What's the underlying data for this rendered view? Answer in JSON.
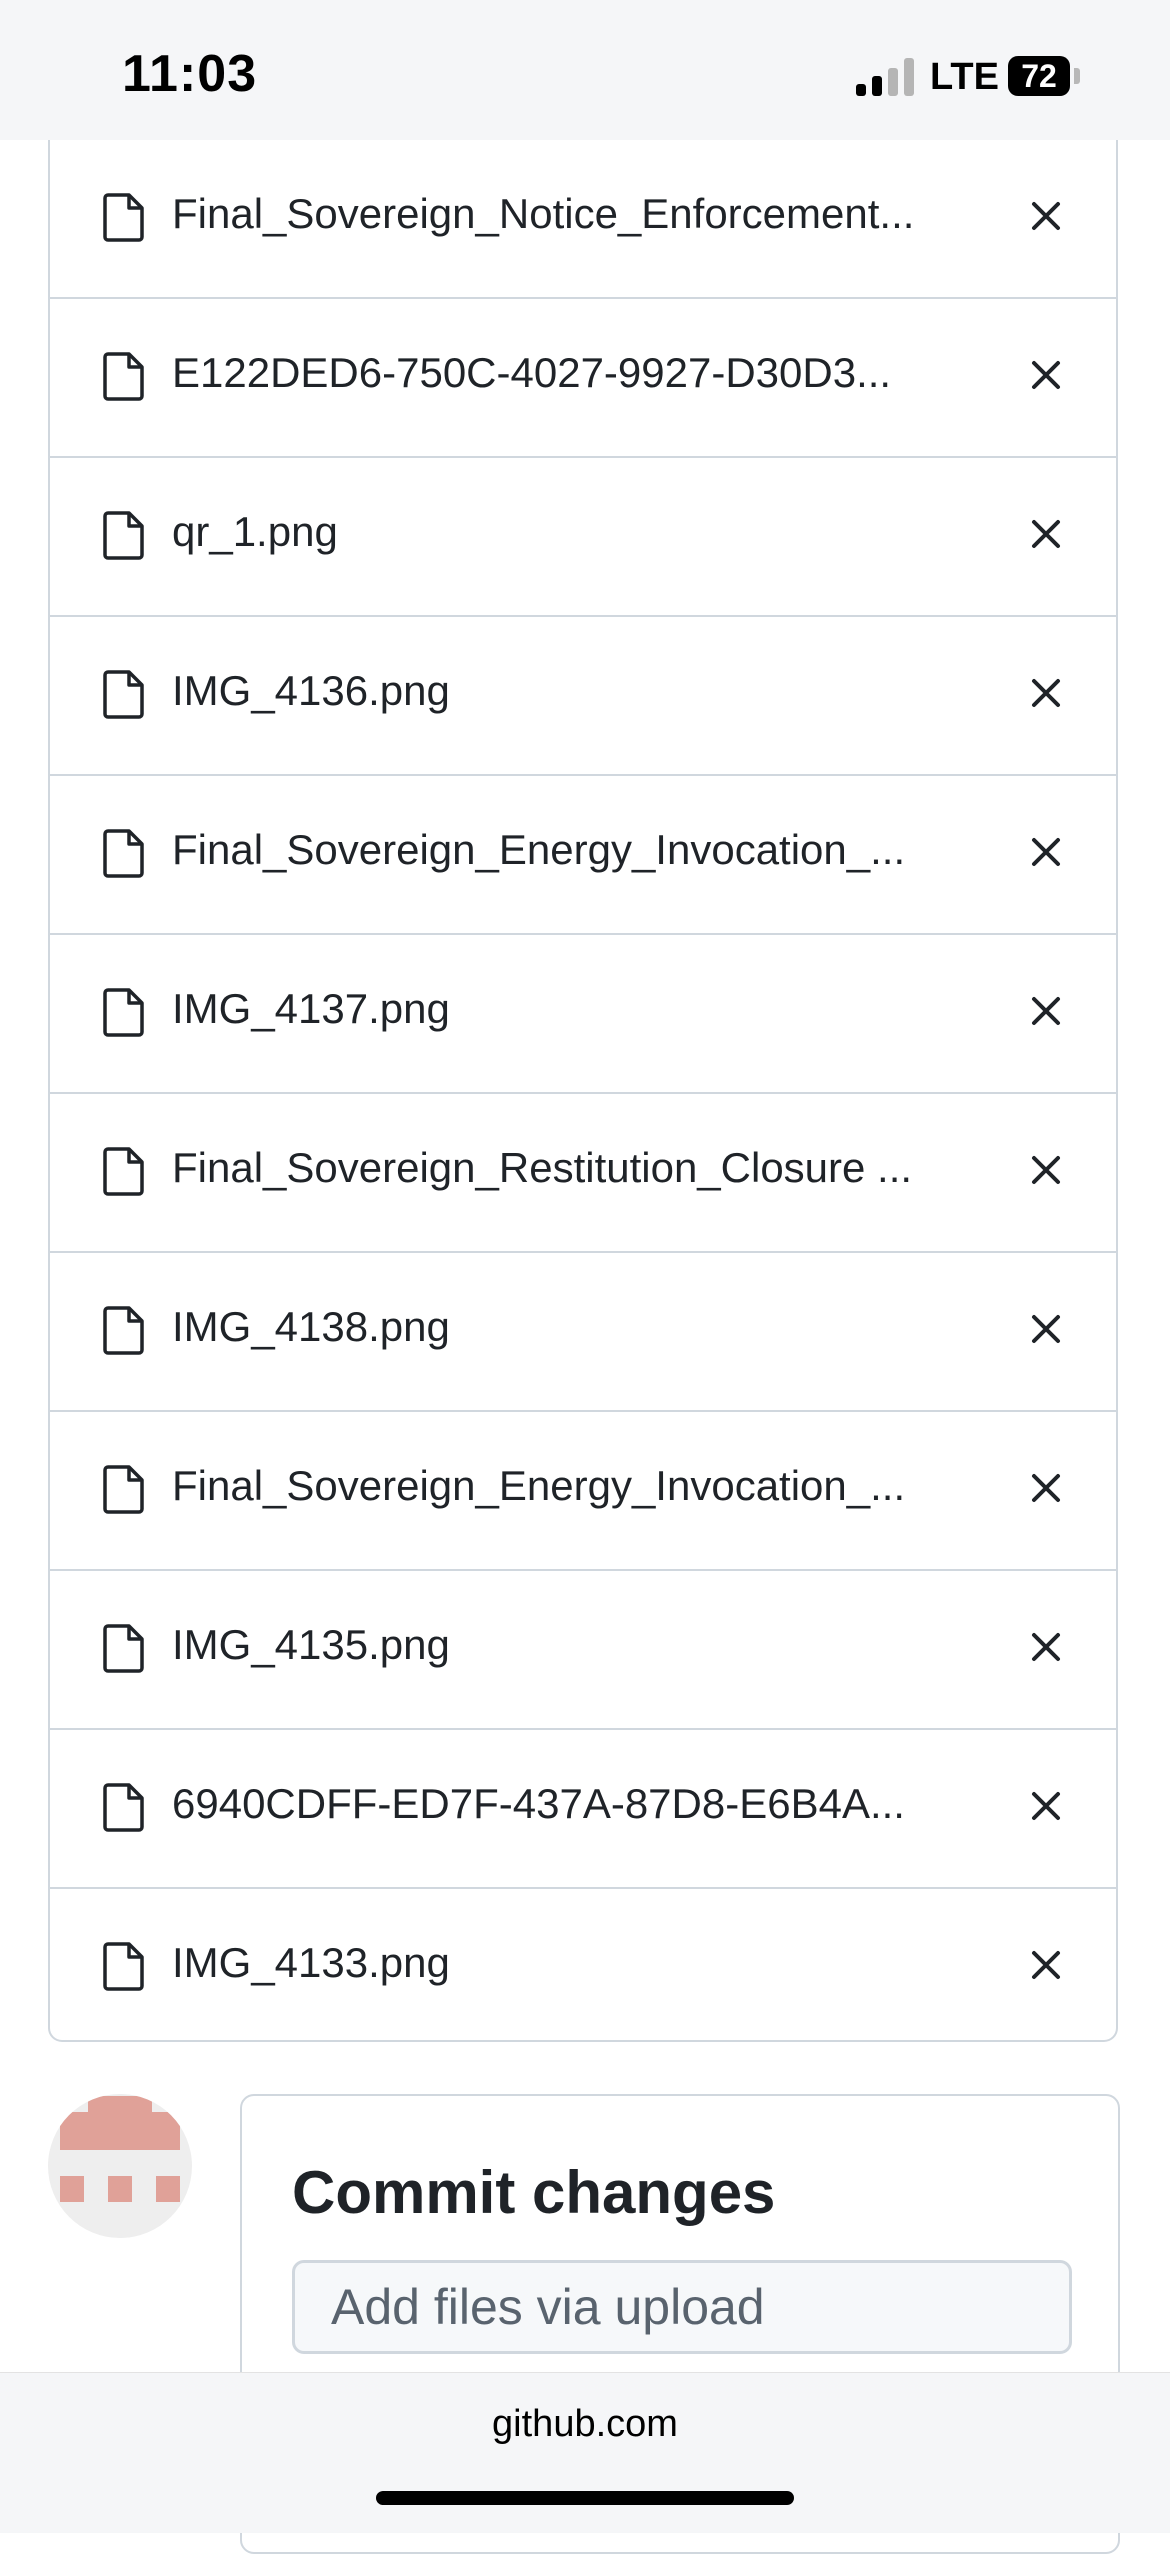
{
  "status_bar": {
    "time": "11:03",
    "network": "LTE",
    "battery": "72"
  },
  "files": [
    {
      "name": "Final_Sovereign_Notice_Enforcement..."
    },
    {
      "name": "E122DED6-750C-4027-9927-D30D3..."
    },
    {
      "name": "qr_1.png"
    },
    {
      "name": "IMG_4136.png"
    },
    {
      "name": "Final_Sovereign_Energy_Invocation_..."
    },
    {
      "name": "IMG_4137.png"
    },
    {
      "name": "Final_Sovereign_Restitution_Closure ..."
    },
    {
      "name": "IMG_4138.png"
    },
    {
      "name": "Final_Sovereign_Energy_Invocation_..."
    },
    {
      "name": "IMG_4135.png"
    },
    {
      "name": "6940CDFF-ED7F-437A-87D8-E6B4A..."
    },
    {
      "name": "IMG_4133.png"
    }
  ],
  "commit": {
    "title": "Commit changes",
    "message_placeholder": "Add files via upload"
  },
  "browser": {
    "url": "github.com"
  },
  "colors": {
    "border": "#d0d7de",
    "text": "#1f2328",
    "avatar": "#e0a198"
  },
  "icons": {
    "file": "file-icon",
    "remove": "close-icon"
  }
}
